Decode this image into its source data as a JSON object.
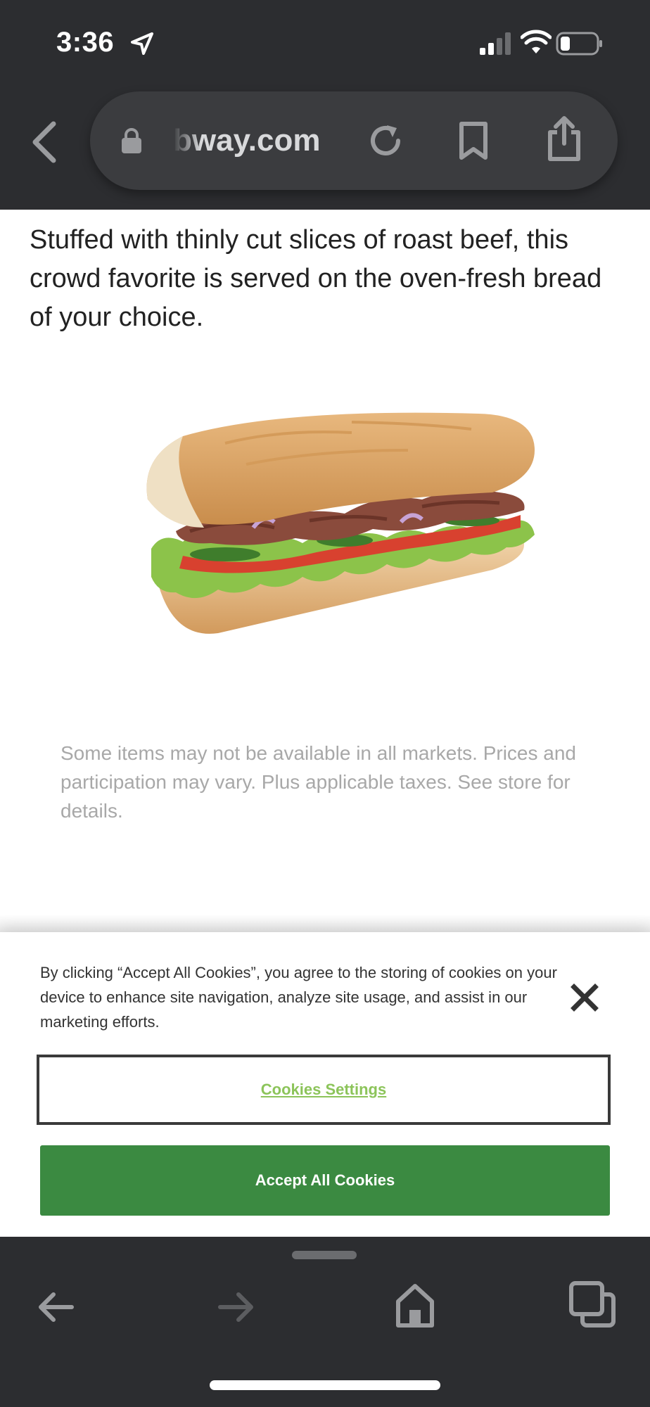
{
  "status_bar": {
    "time": "3:36",
    "icons": [
      "location-arrow-icon",
      "cellular-signal-icon",
      "wifi-icon",
      "battery-icon"
    ]
  },
  "browser": {
    "url_text": "bway.com",
    "icons": [
      "back-chevron-icon",
      "lock-icon",
      "reload-icon",
      "bookmark-icon",
      "share-icon"
    ]
  },
  "content": {
    "description": "Stuffed with thinly cut slices of roast beef, this crowd favorite is served on the oven-fresh bread of your choice.",
    "disclaimer": "Some items may not be available in all markets. Prices and participation may vary. Plus applicable taxes. See store for details."
  },
  "cookie_banner": {
    "text": "By clicking “Accept All Cookies”, you agree to the storing of cookies on your device to enhance site navigation, analyze site usage, and assist in our marketing efforts.",
    "settings_label": "Cookies Settings",
    "accept_label": "Accept All Cookies",
    "colors": {
      "accept_bg": "#3b8a41",
      "settings_text": "#8cc45a"
    }
  },
  "bottom_bar": {
    "icons": [
      "back-arrow-icon",
      "forward-arrow-icon",
      "home-icon",
      "tabs-icon"
    ]
  }
}
